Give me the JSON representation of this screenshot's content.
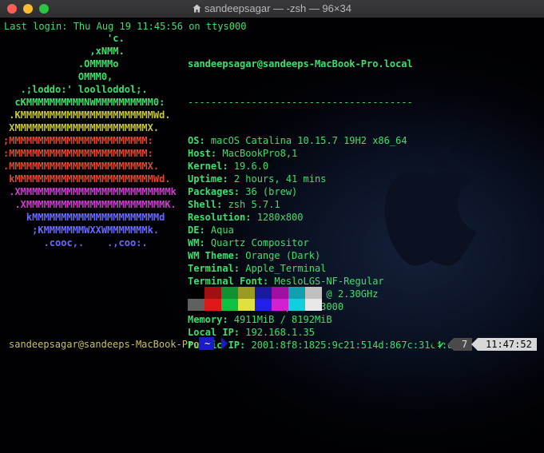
{
  "window": {
    "title": "sandeepsagar — -zsh — 96×34",
    "colors": {
      "close": "#fe5f57",
      "minimize": "#febb2e",
      "maximize": "#29c840"
    }
  },
  "terminal": {
    "last_login": "Last login: Thu Aug 19 11:45:56 on ttys000",
    "logo": [
      {
        "text": "                  'c.",
        "color": "#3be06a"
      },
      {
        "text": "               ,xNMM.",
        "color": "#3be06a"
      },
      {
        "text": "             .OMMMMo",
        "color": "#3be06a"
      },
      {
        "text": "             OMMM0,",
        "color": "#3be06a"
      },
      {
        "text": "   .;loddo:' loolloddol;.",
        "color": "#3be06a"
      },
      {
        "text": "  cKMMMMMMMMMMNWMMMMMMMMMM0:",
        "color": "#3be06a"
      },
      {
        "text": " .KMMMMMMMMMMMMMMMMMMMMMMMWd.",
        "color": "#c8c832"
      },
      {
        "text": " XMMMMMMMMMMMMMMMMMMMMMMMX.",
        "color": "#c8c832"
      },
      {
        "text": ";MMMMMMMMMMMMMMMMMMMMMMMM:",
        "color": "#e8452e"
      },
      {
        "text": ":MMMMMMMMMMMMMMMMMMMMMMMM:",
        "color": "#e8452e"
      },
      {
        "text": ".MMMMMMMMMMMMMMMMMMMMMMMMX.",
        "color": "#e8452e"
      },
      {
        "text": " kMMMMMMMMMMMMMMMMMMMMMMMMWd.",
        "color": "#e8452e"
      },
      {
        "text": " .XMMMMMMMMMMMMMMMMMMMMMMMMMMk",
        "color": "#d33bd3"
      },
      {
        "text": "  .XMMMMMMMMMMMMMMMMMMMMMMMMK.",
        "color": "#d33bd3"
      },
      {
        "text": "    kMMMMMMMMMMMMMMMMMMMMMMd",
        "color": "#6a6aff"
      },
      {
        "text": "     ;KMMMMMMMWXXWMMMMMMMk.",
        "color": "#6a6aff"
      },
      {
        "text": "       .cooc,.    .,coo:.",
        "color": "#6a6aff"
      }
    ],
    "neofetch": {
      "user_host": "sandeepsagar@sandeeps-MacBook-Pro.local",
      "separator": "---------------------------------------",
      "rows": [
        {
          "key": "OS",
          "value": "macOS Catalina 10.15.7 19H2 x86_64"
        },
        {
          "key": "Host",
          "value": "MacBookPro8,1"
        },
        {
          "key": "Kernel",
          "value": "19.6.0"
        },
        {
          "key": "Uptime",
          "value": "2 hours, 41 mins"
        },
        {
          "key": "Packages",
          "value": "36 (brew)"
        },
        {
          "key": "Shell",
          "value": "zsh 5.7.1"
        },
        {
          "key": "Resolution",
          "value": "1280x800"
        },
        {
          "key": "DE",
          "value": "Aqua"
        },
        {
          "key": "WM",
          "value": "Quartz Compositor"
        },
        {
          "key": "WM Theme",
          "value": "Orange (Dark)"
        },
        {
          "key": "Terminal",
          "value": "Apple_Terminal"
        },
        {
          "key": "Terminal Font",
          "value": "MesloLGS-NF-Regular"
        },
        {
          "key": "CPU",
          "value": "Intel i5-2415M (4) @ 2.30GHz"
        },
        {
          "key": "GPU",
          "value": "Intel HD Graphics 3000"
        },
        {
          "key": "Memory",
          "value": "4911MiB / 8192MiB"
        },
        {
          "key": "Local IP",
          "value": "192.168.1.35"
        },
        {
          "key": "Public IP",
          "value": "2001:8f8:1825:9c21:514d:867c:31c4:d"
        }
      ],
      "palette_top": [
        "#000000",
        "#a01010",
        "#109030",
        "#9a9a20",
        "#1a1aa0",
        "#a010a0",
        "#10a0b0",
        "#c0c0c0"
      ],
      "palette_bottom": [
        "#606060",
        "#e01818",
        "#10c040",
        "#e0e040",
        "#2020e8",
        "#d020d0",
        "#10d0e0",
        "#e8e8e8"
      ]
    },
    "prompt": {
      "user_host": "sandeepsagar@sandeeps-MacBook-Pro",
      "dir": "~",
      "status_check": "✔",
      "history_number": "7",
      "time": "11:47:52"
    }
  }
}
